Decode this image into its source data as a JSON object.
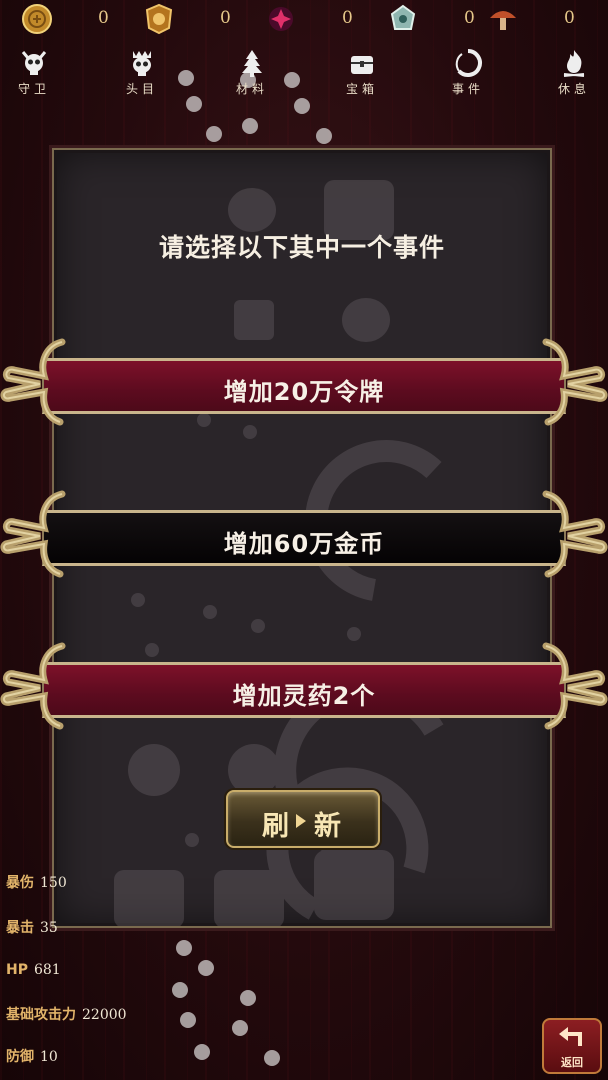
{
  "resources": [
    {
      "icon": "gold-coin-icon",
      "value": "0"
    },
    {
      "icon": "token-badge-icon",
      "value": "0"
    },
    {
      "icon": "red-gem-icon",
      "value": "0"
    },
    {
      "icon": "spirit-stone-icon",
      "value": "0"
    },
    {
      "icon": "mushroom-icon",
      "value": "0"
    }
  ],
  "nav": [
    {
      "label": "守卫",
      "icon": "guard-skull-icon"
    },
    {
      "label": "头目",
      "icon": "boss-skull-icon"
    },
    {
      "label": "材料",
      "icon": "material-tree-icon"
    },
    {
      "label": "宝箱",
      "icon": "treasure-chest-icon"
    },
    {
      "label": "事件",
      "icon": "event-ring-icon"
    },
    {
      "label": "休息",
      "icon": "rest-fire-icon"
    }
  ],
  "event": {
    "prompt": "请选择以下其中一个事件",
    "options": [
      {
        "text": "增加20万令牌",
        "style": "red"
      },
      {
        "text": "增加60万金币",
        "style": "black"
      },
      {
        "text": "增加灵药2个",
        "style": "red"
      }
    ],
    "refresh_label_a": "刷",
    "refresh_label_b": "新"
  },
  "stats": [
    {
      "label": "暴伤",
      "value": "150"
    },
    {
      "label": "暴击",
      "value": "35"
    },
    {
      "label": "HP",
      "value": "681"
    },
    {
      "label": "基础攻击力",
      "value": "22000"
    },
    {
      "label": "防御",
      "value": "10"
    }
  ],
  "back_label": "返回",
  "colors": {
    "option_red": "#7d1129",
    "option_black": "#050304",
    "gold": "#c9b58c",
    "stat_label": "#e2b46a"
  }
}
